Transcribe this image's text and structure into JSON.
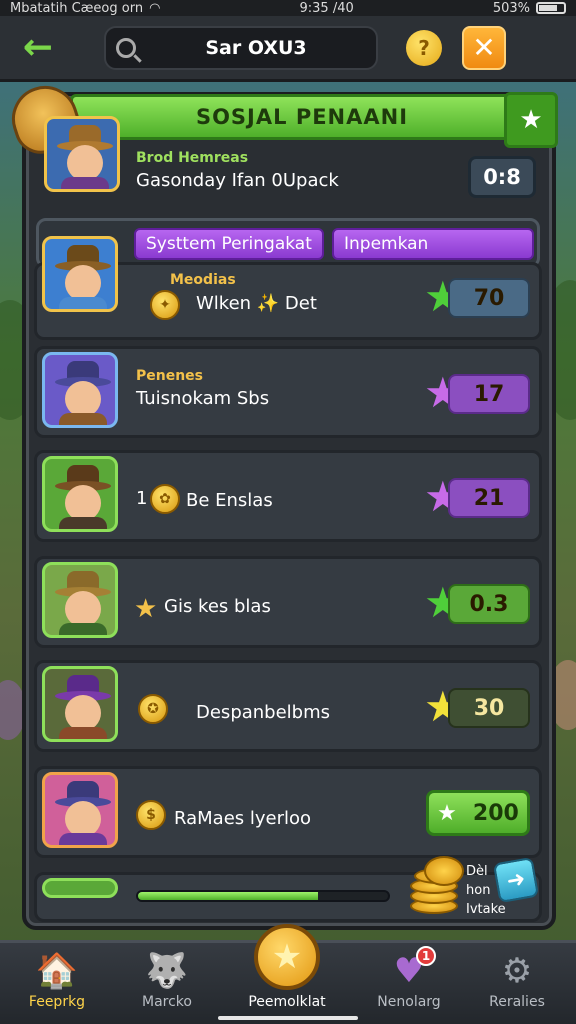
{
  "status_bar": {
    "left_text": "Mbatatih Cæeog orn",
    "center_text": "9:35 /40",
    "right_text": "503%"
  },
  "top_bar": {
    "back_icon": "arrow-left-icon",
    "search_text": "Sar OXU3",
    "help_label": "?",
    "close_label": "✕"
  },
  "banner": {
    "title": "SOSJAL PENAANI",
    "star_icon": "star-badge-icon"
  },
  "profile": {
    "subtitle": "Brod Hemreas",
    "name": "Gasonday Ifan 0Upack",
    "score": "0:8"
  },
  "tabs": [
    {
      "label": "Systtem Peringakat"
    },
    {
      "label": "Inpemkan"
    }
  ],
  "rows": [
    {
      "sublabel": "Meodias",
      "label": "Wlken ✨ Det",
      "score": "70",
      "star_color": "#4fcf3a",
      "box": "score-blue"
    },
    {
      "sublabel": "Penenes",
      "label": "Tuisnokam Sbs",
      "score": "17",
      "star_color": "#c76be8",
      "box": "score-purple"
    },
    {
      "sublabel": "",
      "label": "Be Enslas",
      "prefix": "1",
      "score": "21",
      "star_color": "#c76be8",
      "box": "score-purple"
    },
    {
      "sublabel": "",
      "label": "Gis kes blas",
      "score": "0.3",
      "star_color": "#4fcf3a",
      "box": "score-green"
    },
    {
      "sublabel": "",
      "label": "Despanbelbms",
      "score": "30",
      "star_color": "#f2e13a",
      "box": "score-dark"
    },
    {
      "sublabel": "",
      "label": "RaMaes lyerloo",
      "score": "200",
      "star_color": "#ffffff",
      "box": "reward"
    }
  ],
  "claim": {
    "line1": "Dèl",
    "line2": "hon",
    "line3": "Ivtake"
  },
  "progress": {
    "fraction": 0.72
  },
  "nav": [
    {
      "label": "Feeprkg",
      "icon": "🏠",
      "active": true
    },
    {
      "label": "Marcko",
      "icon": "🐺",
      "active": false
    },
    {
      "label": "Peemolklat",
      "icon": "★",
      "active": false
    },
    {
      "label": "Nenolarg",
      "icon": "♥",
      "active": false
    },
    {
      "label": "Reralies",
      "icon": "⚙",
      "active": false
    }
  ],
  "notif_count": "1"
}
